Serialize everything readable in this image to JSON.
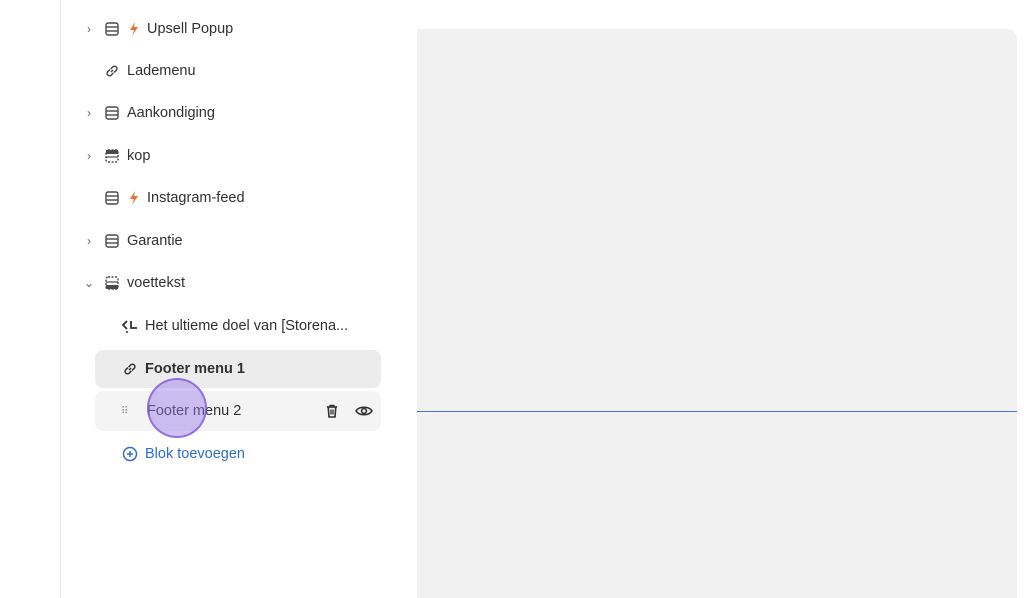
{
  "sidebar": {
    "items": [
      {
        "label": "Upsell Popup",
        "chevron": "›",
        "icon": "section-icon",
        "bolt": true
      },
      {
        "label": "Lademenu",
        "icon": "link-icon"
      },
      {
        "label": "Aankondiging",
        "chevron": "›",
        "icon": "section-icon"
      },
      {
        "label": "kop",
        "chevron": "›",
        "icon": "header-section-icon"
      },
      {
        "label": "Instagram-feed",
        "icon": "section-icon",
        "bolt": true
      },
      {
        "label": "Garantie",
        "chevron": "›",
        "icon": "section-icon"
      },
      {
        "label": "voettekst",
        "chevron": "⌄",
        "icon": "footer-section-icon"
      }
    ],
    "footer_blocks": [
      {
        "label": "Het ultieme doel van [Storena...",
        "icon": "text-block-icon"
      },
      {
        "label": "Footer menu 1",
        "icon": "link-icon",
        "selected": true
      },
      {
        "label": "Footer menu 2",
        "icon": "drag-handle-icon",
        "hovered": true
      }
    ],
    "add_block_label": "Blok toevoegen",
    "actions": {
      "delete": "trash-icon",
      "visibility": "eye-icon"
    }
  },
  "colors": {
    "link_blue": "#2c6ecb",
    "bolt_orange": "#e8742f",
    "preview_bg": "#f1f1f1",
    "drop_line": "#4a78c8",
    "cursor_purple": "#9a78e8"
  }
}
